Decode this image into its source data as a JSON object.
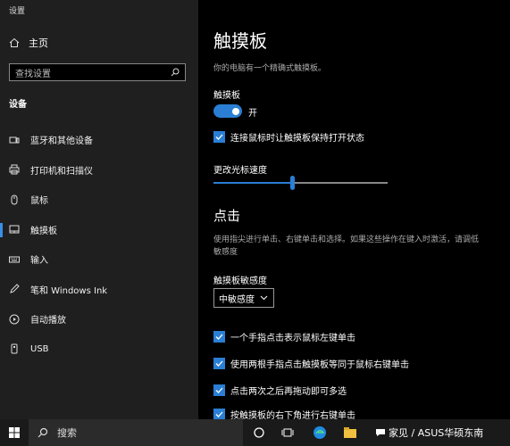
{
  "app": {
    "title": "设置"
  },
  "sidebar": {
    "home_label": "主页",
    "search_placeholder": "查找设置",
    "section_title": "设备",
    "items": [
      {
        "label": "蓝牙和其他设备",
        "icon": "bluetooth-devices-icon"
      },
      {
        "label": "打印机和扫描仪",
        "icon": "printer-icon"
      },
      {
        "label": "鼠标",
        "icon": "mouse-icon"
      },
      {
        "label": "触摸板",
        "icon": "touchpad-icon",
        "active": true
      },
      {
        "label": "输入",
        "icon": "keyboard-icon"
      },
      {
        "label": "笔和 Windows Ink",
        "icon": "pen-icon"
      },
      {
        "label": "自动播放",
        "icon": "autoplay-icon"
      },
      {
        "label": "USB",
        "icon": "usb-icon"
      }
    ]
  },
  "main": {
    "title": "触摸板",
    "description": "你的电脑有一个精确式触摸板。",
    "touchpad_label": "触摸板",
    "toggle_state": "开",
    "toggle_on": true,
    "keep_on_with_mouse": "连接鼠标时让触摸板保持打开状态",
    "cursor_speed_label": "更改光标速度",
    "cursor_speed_value": 0.45,
    "tap_heading": "点击",
    "tap_description": "使用指尖进行单击、右键单击和选择。如果这些操作在键入时激活，请调低敏感度",
    "sensitivity_label": "触摸板敏感度",
    "sensitivity_value": "中敏感度",
    "options": [
      "一个手指点击表示鼠标左键单击",
      "使用两根手指点击触摸板等同于鼠标右键单击",
      "点击两次之后再拖动即可多选",
      "按触摸板的右下角进行右键单击"
    ]
  },
  "taskbar": {
    "search_label": "搜索",
    "watermark": "家见 / ASUS华硕东南"
  },
  "colors": {
    "accent": "#2a7fd4",
    "sidebar_bg": "#1f1f1f",
    "main_bg": "#000000"
  }
}
